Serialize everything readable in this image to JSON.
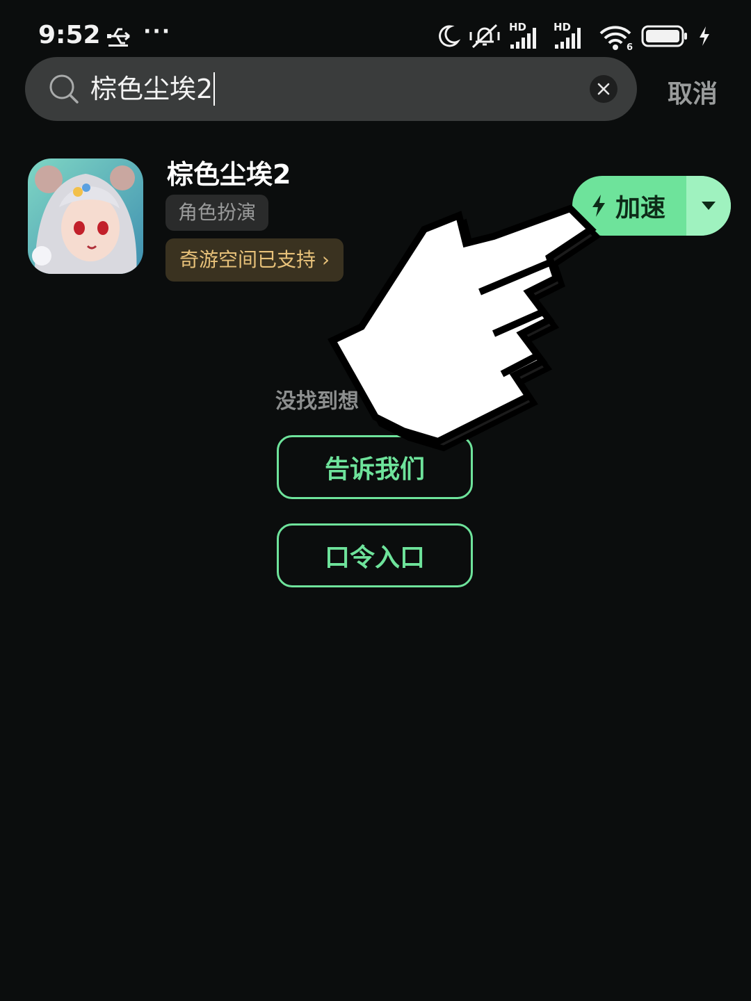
{
  "status_bar": {
    "time": "9:52",
    "more": "···",
    "icons": [
      "usb-icon",
      "moon-icon",
      "vibrate-silent-icon",
      "hd-signal-icon",
      "hd-signal-icon",
      "wifi-icon",
      "battery-icon",
      "charging-icon"
    ],
    "hd_label": "HD",
    "wifi_label": "6"
  },
  "search": {
    "query": "棕色尘埃2",
    "cancel_label": "取消"
  },
  "result": {
    "title": "棕色尘埃2",
    "genre": "角色扮演",
    "support_label": "奇游空间已支持 ›",
    "accelerate_label": "加速"
  },
  "empty_state": {
    "not_found": "没找到想",
    "tell_us_label": "告诉我们",
    "code_entry_label": "口令入口"
  },
  "colors": {
    "background": "#0b0d0d",
    "accent": "#6ee39b",
    "accent_light": "#9ff2bf",
    "support_text": "#e8c27a"
  }
}
